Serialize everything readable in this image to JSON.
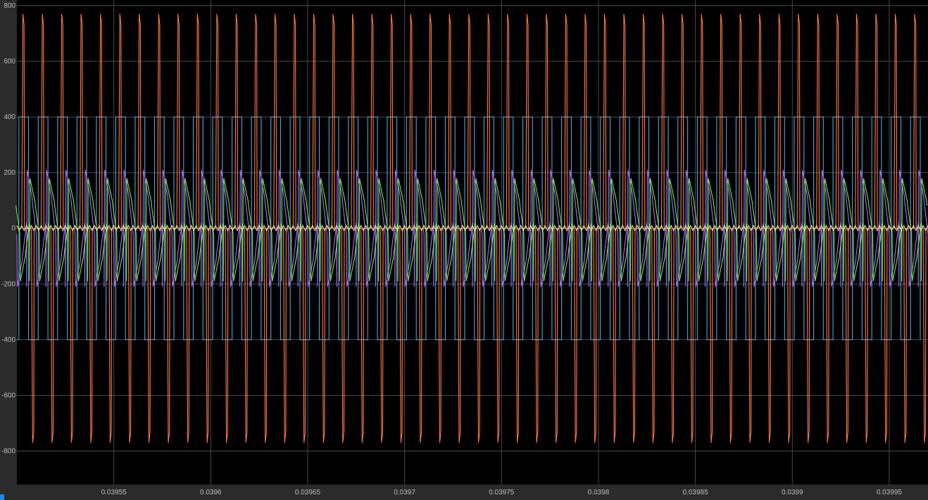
{
  "chart_data": {
    "type": "line",
    "title": "",
    "xlabel": "",
    "ylabel": "",
    "xlim": [
      0.0395,
      0.03997
    ],
    "ylim": [
      -920,
      820
    ],
    "grid": true,
    "background": "#000000",
    "axes_background": "#2b2b2b",
    "grid_color": "#4a4a4a",
    "x_ticks": [
      0.03955,
      0.0396,
      0.03965,
      0.0397,
      0.03975,
      0.0398,
      0.03985,
      0.0399,
      0.03995
    ],
    "x_tick_labels": [
      "0.03955",
      "0.0396",
      "0.03965",
      "0.0397",
      "0.03975",
      "0.0398",
      "0.03985",
      "0.0399",
      "0.03995"
    ],
    "y_ticks": [
      800,
      600,
      400,
      200,
      0,
      -200,
      -400,
      -600,
      -800
    ],
    "y_tick_labels": [
      "800",
      "600",
      "400",
      "200",
      "0",
      "-200",
      "-400",
      "-600",
      "-800"
    ],
    "switching_period": 1e-05,
    "series": [
      {
        "color": "#4fa3e0",
        "shape": "square",
        "high": 400,
        "low": -400,
        "first_rise": 0.039501,
        "duty": 0.5
      },
      {
        "color": "#ff7a45",
        "shape": "pulse-pair",
        "high": 770,
        "low": -770,
        "phase": 2.5e-06
      },
      {
        "color": "#b06bff",
        "shape": "sawtooth",
        "high": 210,
        "low": -210,
        "phase": 5e-06
      },
      {
        "color": "#7fe34a",
        "shape": "sawtooth",
        "high": 180,
        "low": -190,
        "phase": 6.5e-06
      },
      {
        "color": "#e8e8a8",
        "shape": "ripple",
        "high": 10,
        "low": -8,
        "phase": 0
      }
    ]
  }
}
